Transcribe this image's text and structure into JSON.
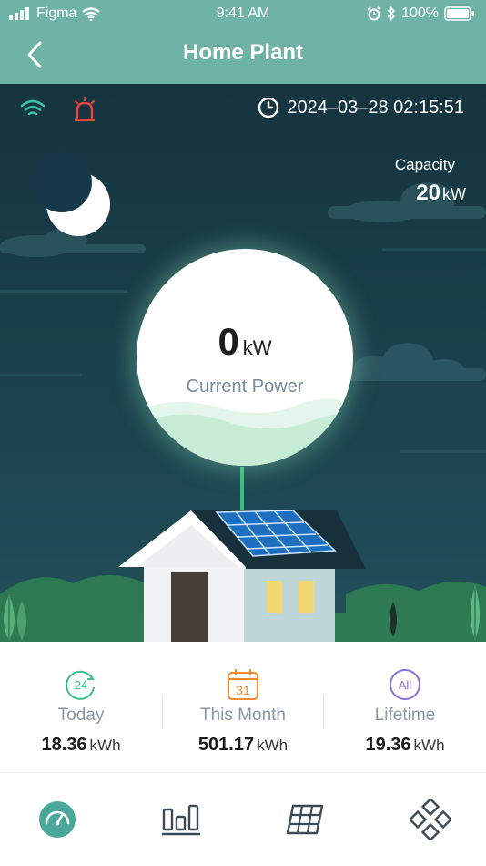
{
  "status_bar": {
    "carrier": "Figma",
    "time": "9:41 AM",
    "battery": "100%"
  },
  "header": {
    "title": "Home Plant"
  },
  "scene": {
    "datetime": "2024–03–28 02:15:51",
    "capacity_label": "Capacity",
    "capacity_value": "20",
    "capacity_unit": "kW",
    "current_power_value": "0",
    "current_power_unit": "kW",
    "current_power_label": "Current Power"
  },
  "stats": [
    {
      "icon_text": "24",
      "label": "Today",
      "value": "18.36",
      "unit": "kWh",
      "color": "#3fbf8a"
    },
    {
      "icon_text": "31",
      "label": "This Month",
      "value": "501.17",
      "unit": "kWh",
      "color": "#ef8a2e"
    },
    {
      "icon_text": "All",
      "label": "Lifetime",
      "value": "19.36",
      "unit": "kWh",
      "color": "#8a6fd6"
    }
  ],
  "tabs": [
    {
      "icon": "dashboard-gauge-icon",
      "active": true
    },
    {
      "icon": "bar-chart-icon",
      "active": false
    },
    {
      "icon": "solar-panel-icon",
      "active": false
    },
    {
      "icon": "devices-grid-icon",
      "active": false
    }
  ],
  "colors": {
    "header": "#6fb3a6",
    "accent": "#4aa89a",
    "alarm": "#e6483d",
    "sky": "#1b424d"
  }
}
